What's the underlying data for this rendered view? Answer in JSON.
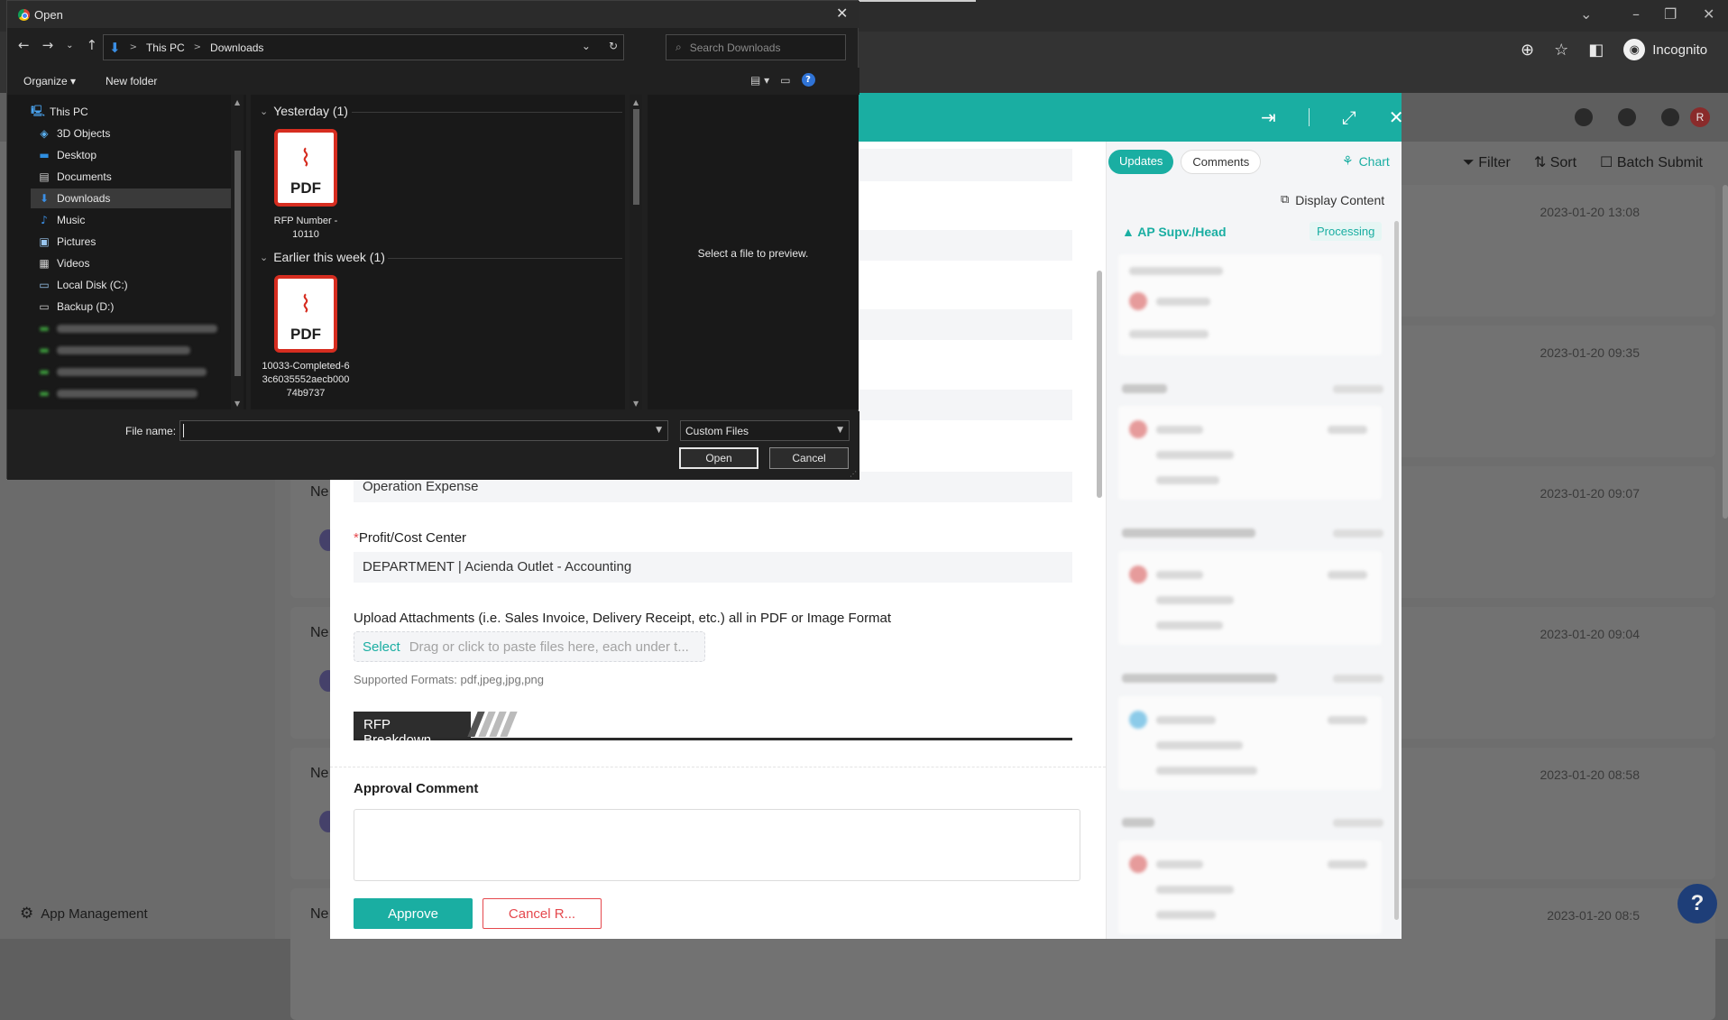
{
  "browser": {
    "incognito_label": "Incognito",
    "avatar_letter": "R"
  },
  "app": {
    "toolbar": {
      "filter": "Filter",
      "sort": "Sort",
      "batch_submit": "Batch Submit"
    },
    "sidebar": {
      "app_management": "App Management"
    },
    "list": {
      "rows": [
        {
          "title": "",
          "date": "2023-01-20 13:08"
        },
        {
          "title": "",
          "date": "2023-01-20 09:35"
        },
        {
          "title": "Ne",
          "date": "2023-01-20 09:07"
        },
        {
          "title": "Ne",
          "date": "2023-01-20 09:04"
        },
        {
          "title": "Ne",
          "date": "2023-01-20 08:58"
        },
        {
          "title": "Ne",
          "date": "2023-01-20 08:5"
        }
      ]
    },
    "help_label": "?"
  },
  "form": {
    "expense_value": "Operation Expense",
    "profit_center_label": "Profit/Cost Center",
    "profit_center_required": "*",
    "profit_center_value": "DEPARTMENT | Acienda Outlet - Accounting",
    "upload_label": "Upload Attachments (i.e. Sales Invoice, Delivery Receipt, etc.) all in PDF or Image Format",
    "upload_select": "Select",
    "upload_hint": "Drag or click to paste files here, each under t...",
    "supported_formats": "Supported Formats: pdf,jpeg,jpg,png",
    "rfp_breakdown": "RFP Breakdown",
    "approval_comment_label": "Approval Comment",
    "approval_comment_value": "",
    "approve_btn": "Approve",
    "cancel_btn": "Cancel R..."
  },
  "process": {
    "tabs": [
      "Updates",
      "Comments"
    ],
    "chart_label": "Chart",
    "display_content": "Display Content",
    "current_stage": "AP Supv./Head",
    "current_stage_status": "Processing"
  },
  "dialog": {
    "title": "Open",
    "breadcrumb": [
      "This PC",
      "Downloads"
    ],
    "search_placeholder": "Search Downloads",
    "organize": "Organize",
    "new_folder": "New folder",
    "nav_items": [
      {
        "label": "This PC",
        "icon": "computer-icon"
      },
      {
        "label": "3D Objects",
        "icon": "cube-icon"
      },
      {
        "label": "Desktop",
        "icon": "desktop-icon"
      },
      {
        "label": "Documents",
        "icon": "document-icon"
      },
      {
        "label": "Downloads",
        "icon": "download-icon"
      },
      {
        "label": "Music",
        "icon": "music-icon"
      },
      {
        "label": "Pictures",
        "icon": "picture-icon"
      },
      {
        "label": "Videos",
        "icon": "video-icon"
      },
      {
        "label": "Local Disk (C:)",
        "icon": "disk-icon"
      },
      {
        "label": "Backup (D:)",
        "icon": "disk-icon"
      }
    ],
    "groups": [
      {
        "label": "Yesterday (1)",
        "file": "RFP Number - 10110"
      },
      {
        "label": "Earlier this week (1)",
        "file": "10033-Completed-63c6035552aecb00074b9737"
      }
    ],
    "pdf_label": "PDF",
    "preview_text": "Select a file to preview.",
    "file_name_label": "File name:",
    "file_name_value": "",
    "file_type": "Custom Files",
    "open_btn": "Open",
    "cancel_btn": "Cancel"
  }
}
